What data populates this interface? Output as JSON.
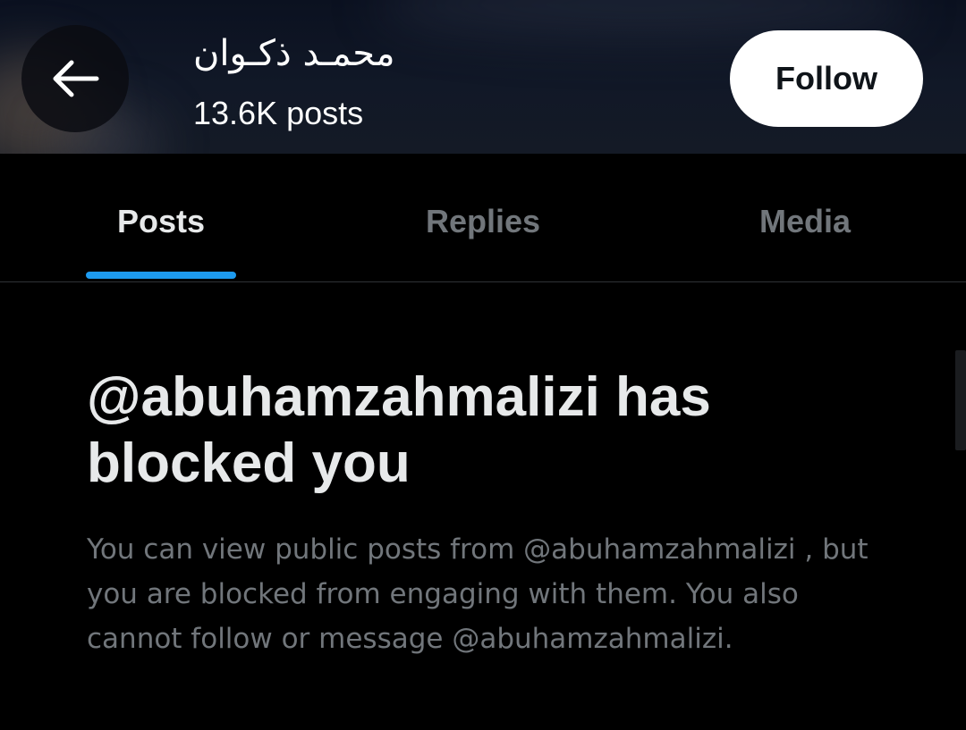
{
  "header": {
    "back_icon": "arrow-left-icon",
    "profile_name": "محمـد ذكـوان",
    "post_count": "13.6K posts",
    "follow_label": "Follow"
  },
  "tabs": [
    {
      "label": "Posts",
      "active": true
    },
    {
      "label": "Replies",
      "active": false
    },
    {
      "label": "Media",
      "active": false
    }
  ],
  "blocked": {
    "title": "@abuhamzahmalizi has blocked you",
    "message": "You can view public posts from @abuhamzahmalizi , but you are blocked from engaging with them. You also cannot follow or message @abuhamzahmalizi."
  },
  "colors": {
    "accent": "#1d9bf0",
    "text_primary": "#e7e9ea",
    "text_secondary": "#71767b",
    "background": "#000000",
    "follow_button_bg": "#ffffff"
  }
}
